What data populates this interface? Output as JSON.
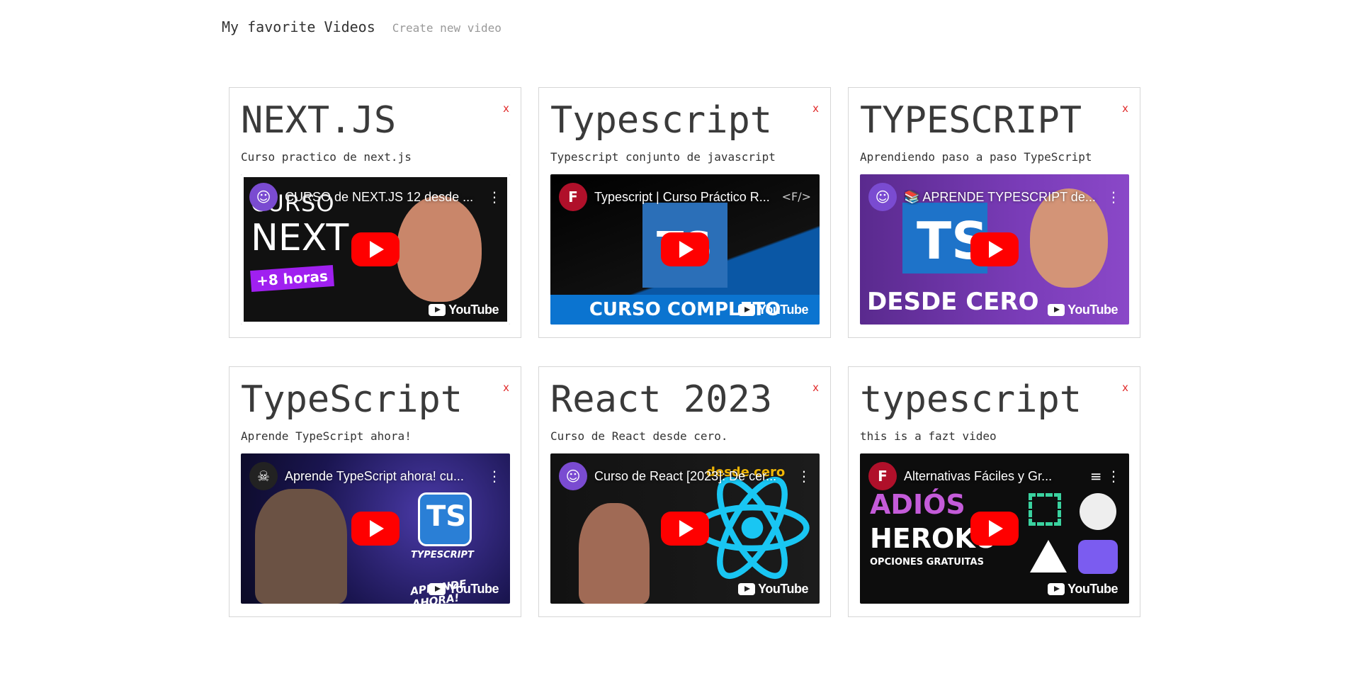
{
  "nav": {
    "brand": "My favorite Videos",
    "create_link": "Create new video"
  },
  "close_label": "x",
  "youtube_label": "YouTube",
  "videos": [
    {
      "title": "NEXT.JS",
      "description": "Curso practico de next.js",
      "video_title": "CURSO de NEXT.JS 12 desde ...",
      "thumb_text": [
        "CURSO",
        "NEXT",
        "+8 horas"
      ]
    },
    {
      "title": "Typescript",
      "description": "Typescript conjunto de javascript",
      "video_title": "Typescript | Curso Práctico R...",
      "thumb_text": [
        "TS",
        "CURSO COMPLETO"
      ]
    },
    {
      "title": "TYPESCRIPT",
      "description": "Aprendiendo paso a paso TypeScript",
      "video_title": "📚 APRENDE TYPESCRIPT de...",
      "thumb_text": [
        "TS",
        "DESDE CERO"
      ]
    },
    {
      "title": "TypeScript",
      "description": "Aprende TypeScript ahora!",
      "video_title": "Aprende TypeScript ahora! cu...",
      "thumb_text": [
        "TS",
        "TYPESCRIPT",
        "APRENDE AHORA!"
      ]
    },
    {
      "title": "React 2023",
      "description": "Curso de React desde cero.",
      "video_title": "Curso de React [2023]: De cer...",
      "thumb_text": [
        "desde cero"
      ]
    },
    {
      "title": "typescript",
      "description": "this is a fazt video",
      "video_title": "Alternativas Fáciles y Gr...",
      "thumb_text": [
        "ADIÓS",
        "HEROKU",
        "OPCIONES GRATUITAS"
      ]
    }
  ],
  "colors": {
    "close": "#e02424",
    "play_button": "#ff0000",
    "border": "#d6d6d6"
  }
}
